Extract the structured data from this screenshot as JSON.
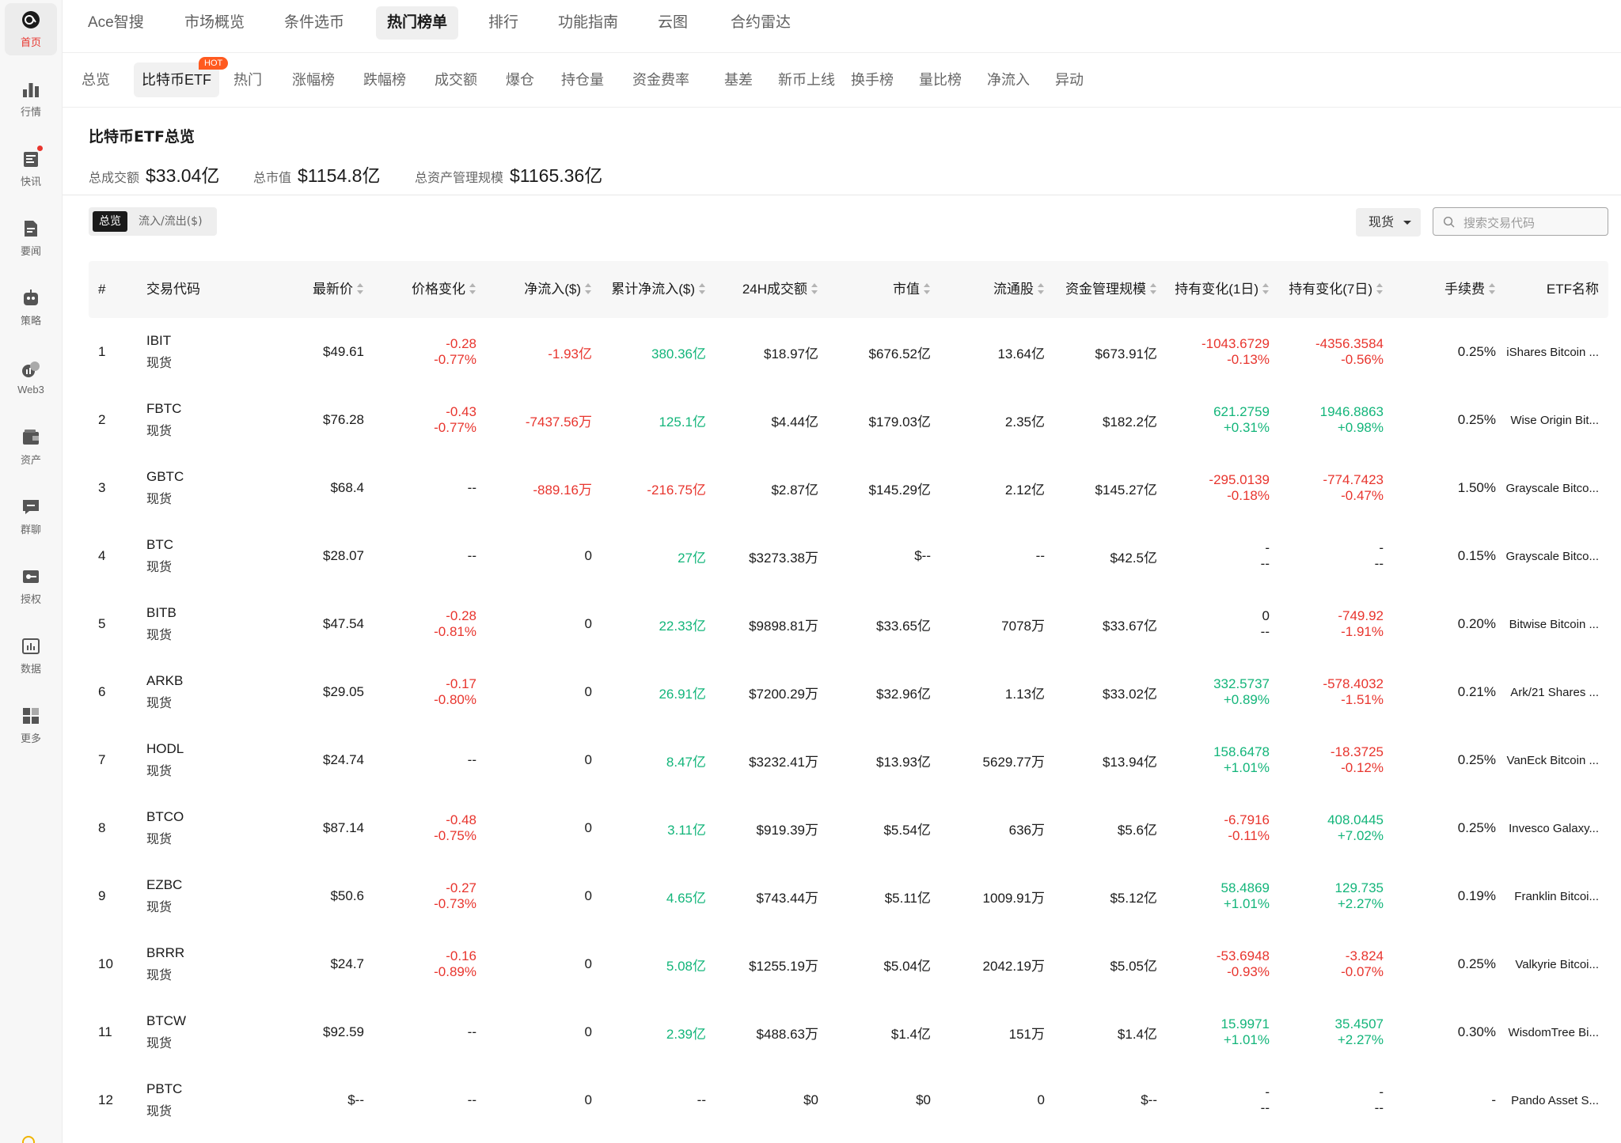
{
  "rail": [
    {
      "name": "rail-home",
      "icon": "home-logo-icon",
      "label": "首页",
      "active": true
    },
    {
      "name": "rail-market",
      "icon": "bar-chart-icon",
      "label": "行情"
    },
    {
      "name": "rail-flash",
      "icon": "news-icon",
      "label": "快讯"
    },
    {
      "name": "rail-news",
      "icon": "document-icon",
      "label": "要闻"
    },
    {
      "name": "rail-strategy",
      "icon": "robot-icon",
      "label": "策略"
    },
    {
      "name": "rail-web3",
      "icon": "web3-icon",
      "label": "Web3"
    },
    {
      "name": "rail-assets",
      "icon": "wallet-icon",
      "label": "资产"
    },
    {
      "name": "rail-chat",
      "icon": "chat-icon",
      "label": "群聊"
    },
    {
      "name": "rail-auth",
      "icon": "key-icon",
      "label": "授权"
    },
    {
      "name": "rail-data",
      "icon": "data-icon",
      "label": "数据"
    },
    {
      "name": "rail-more",
      "icon": "grid-icon",
      "label": "更多"
    }
  ],
  "topnav": [
    "Ace智搜",
    "市场概览",
    "条件选币",
    "热门榜单",
    "排行",
    "功能指南",
    "云图",
    "合约雷达"
  ],
  "topnav_active": "热门榜单",
  "subnav": [
    "总览",
    "比特币ETF",
    "热门",
    "涨幅榜",
    "跌幅榜",
    "成交额",
    "爆仓",
    "持仓量",
    "资金费率",
    "基差",
    "新币上线",
    "换手榜",
    "量比榜",
    "净流入",
    "异动"
  ],
  "subnav_active": "比特币ETF",
  "hot_badge": "HOT",
  "overview": {
    "title": "比特币ETF总览",
    "stats": [
      {
        "label": "总成交额",
        "value": "$33.04亿"
      },
      {
        "label": "总市值",
        "value": "$1154.8亿"
      },
      {
        "label": "总资产管理规模",
        "value": "$1165.36亿"
      }
    ]
  },
  "toggle": {
    "on": "总览",
    "off": "流入/流出($)"
  },
  "market_select": "现货",
  "search": {
    "placeholder": "搜索交易代码",
    "value": ""
  },
  "colors": {
    "up": "#13b57a",
    "down": "#e8352e",
    "accent": "#e8352e",
    "hot": "#ff5a1f"
  },
  "table": {
    "headers": [
      "#",
      "交易代码",
      "最新价",
      "价格变化",
      "净流入($)",
      "累计净流入($)",
      "24H成交额",
      "市值",
      "流通股",
      "资金管理规模",
      "持有变化(1日)",
      "持有变化(7日)",
      "手续费",
      "ETF名称"
    ],
    "rows": [
      {
        "n": "1",
        "code": "IBIT",
        "type": "现货",
        "price": "$49.61",
        "chg": [
          "-0.28",
          "-0.77%"
        ],
        "chg_c": "red",
        "net": "-1.93亿",
        "net_c": "red",
        "cum": "380.36亿",
        "cum_c": "green",
        "vol": "$18.97亿",
        "mcap": "$676.52亿",
        "shares": "13.64亿",
        "aum": "$673.91亿",
        "h1": [
          "-1043.6729",
          "-0.13%"
        ],
        "h1_c": "red",
        "h7": [
          "-4356.3584",
          "-0.56%"
        ],
        "h7_c": "red",
        "fee": "0.25%",
        "etf": "iShares Bitcoin ..."
      },
      {
        "n": "2",
        "code": "FBTC",
        "type": "现货",
        "price": "$76.28",
        "chg": [
          "-0.43",
          "-0.77%"
        ],
        "chg_c": "red",
        "net": "-7437.56万",
        "net_c": "red",
        "cum": "125.1亿",
        "cum_c": "green",
        "vol": "$4.44亿",
        "mcap": "$179.03亿",
        "shares": "2.35亿",
        "aum": "$182.2亿",
        "h1": [
          "621.2759",
          "+0.31%"
        ],
        "h1_c": "green",
        "h7": [
          "1946.8863",
          "+0.98%"
        ],
        "h7_c": "green",
        "fee": "0.25%",
        "etf": "Wise Origin Bit..."
      },
      {
        "n": "3",
        "code": "GBTC",
        "type": "现货",
        "price": "$68.4",
        "chg": [
          "--",
          ""
        ],
        "chg_c": "",
        "net": "-889.16万",
        "net_c": "red",
        "cum": "-216.75亿",
        "cum_c": "red",
        "vol": "$2.87亿",
        "mcap": "$145.29亿",
        "shares": "2.12亿",
        "aum": "$145.27亿",
        "h1": [
          "-295.0139",
          "-0.18%"
        ],
        "h1_c": "red",
        "h7": [
          "-774.7423",
          "-0.47%"
        ],
        "h7_c": "red",
        "fee": "1.50%",
        "etf": "Grayscale Bitco..."
      },
      {
        "n": "4",
        "code": "BTC",
        "type": "现货",
        "price": "$28.07",
        "chg": [
          "--",
          ""
        ],
        "chg_c": "",
        "net": "0",
        "net_c": "",
        "cum": "27亿",
        "cum_c": "green",
        "vol": "$3273.38万",
        "mcap": "$--",
        "shares": "--",
        "aum": "$42.5亿",
        "h1": [
          "-",
          "--"
        ],
        "h1_c": "",
        "h7": [
          "-",
          "--"
        ],
        "h7_c": "",
        "fee": "0.15%",
        "etf": "Grayscale Bitco..."
      },
      {
        "n": "5",
        "code": "BITB",
        "type": "现货",
        "price": "$47.54",
        "chg": [
          "-0.28",
          "-0.81%"
        ],
        "chg_c": "red",
        "net": "0",
        "net_c": "",
        "cum": "22.33亿",
        "cum_c": "green",
        "vol": "$9898.81万",
        "mcap": "$33.65亿",
        "shares": "7078万",
        "aum": "$33.67亿",
        "h1": [
          "0",
          "--"
        ],
        "h1_c": "",
        "h7": [
          "-749.92",
          "-1.91%"
        ],
        "h7_c": "red",
        "fee": "0.20%",
        "etf": "Bitwise Bitcoin ..."
      },
      {
        "n": "6",
        "code": "ARKB",
        "type": "现货",
        "price": "$29.05",
        "chg": [
          "-0.17",
          "-0.80%"
        ],
        "chg_c": "red",
        "net": "0",
        "net_c": "",
        "cum": "26.91亿",
        "cum_c": "green",
        "vol": "$7200.29万",
        "mcap": "$32.96亿",
        "shares": "1.13亿",
        "aum": "$33.02亿",
        "h1": [
          "332.5737",
          "+0.89%"
        ],
        "h1_c": "green",
        "h7": [
          "-578.4032",
          "-1.51%"
        ],
        "h7_c": "red",
        "fee": "0.21%",
        "etf": "Ark/21 Shares ..."
      },
      {
        "n": "7",
        "code": "HODL",
        "type": "现货",
        "price": "$24.74",
        "chg": [
          "--",
          ""
        ],
        "chg_c": "",
        "net": "0",
        "net_c": "",
        "cum": "8.47亿",
        "cum_c": "green",
        "vol": "$3232.41万",
        "mcap": "$13.93亿",
        "shares": "5629.77万",
        "aum": "$13.94亿",
        "h1": [
          "158.6478",
          "+1.01%"
        ],
        "h1_c": "green",
        "h7": [
          "-18.3725",
          "-0.12%"
        ],
        "h7_c": "red",
        "fee": "0.25%",
        "etf": "VanEck Bitcoin ..."
      },
      {
        "n": "8",
        "code": "BTCO",
        "type": "现货",
        "price": "$87.14",
        "chg": [
          "-0.48",
          "-0.75%"
        ],
        "chg_c": "red",
        "net": "0",
        "net_c": "",
        "cum": "3.11亿",
        "cum_c": "green",
        "vol": "$919.39万",
        "mcap": "$5.54亿",
        "shares": "636万",
        "aum": "$5.6亿",
        "h1": [
          "-6.7916",
          "-0.11%"
        ],
        "h1_c": "red",
        "h7": [
          "408.0445",
          "+7.02%"
        ],
        "h7_c": "green",
        "fee": "0.25%",
        "etf": "Invesco Galaxy..."
      },
      {
        "n": "9",
        "code": "EZBC",
        "type": "现货",
        "price": "$50.6",
        "chg": [
          "-0.27",
          "-0.73%"
        ],
        "chg_c": "red",
        "net": "0",
        "net_c": "",
        "cum": "4.65亿",
        "cum_c": "green",
        "vol": "$743.44万",
        "mcap": "$5.11亿",
        "shares": "1009.91万",
        "aum": "$5.12亿",
        "h1": [
          "58.4869",
          "+1.01%"
        ],
        "h1_c": "green",
        "h7": [
          "129.735",
          "+2.27%"
        ],
        "h7_c": "green",
        "fee": "0.19%",
        "etf": "Franklin Bitcoi..."
      },
      {
        "n": "10",
        "code": "BRRR",
        "type": "现货",
        "price": "$24.7",
        "chg": [
          "-0.16",
          "-0.89%"
        ],
        "chg_c": "red",
        "net": "0",
        "net_c": "",
        "cum": "5.08亿",
        "cum_c": "green",
        "vol": "$1255.19万",
        "mcap": "$5.04亿",
        "shares": "2042.19万",
        "aum": "$5.05亿",
        "h1": [
          "-53.6948",
          "-0.93%"
        ],
        "h1_c": "red",
        "h7": [
          "-3.824",
          "-0.07%"
        ],
        "h7_c": "red",
        "fee": "0.25%",
        "etf": "Valkyrie Bitcoi..."
      },
      {
        "n": "11",
        "code": "BTCW",
        "type": "现货",
        "price": "$92.59",
        "chg": [
          "--",
          ""
        ],
        "chg_c": "",
        "net": "0",
        "net_c": "",
        "cum": "2.39亿",
        "cum_c": "green",
        "vol": "$488.63万",
        "mcap": "$1.4亿",
        "shares": "151万",
        "aum": "$1.4亿",
        "h1": [
          "15.9971",
          "+1.01%"
        ],
        "h1_c": "green",
        "h7": [
          "35.4507",
          "+2.27%"
        ],
        "h7_c": "green",
        "fee": "0.30%",
        "etf": "WisdomTree Bi..."
      },
      {
        "n": "12",
        "code": "PBTC",
        "type": "现货",
        "price": "$--",
        "chg": [
          "--",
          ""
        ],
        "chg_c": "",
        "net": "0",
        "net_c": "",
        "cum": "--",
        "cum_c": "",
        "vol": "$0",
        "mcap": "$0",
        "shares": "0",
        "aum": "$--",
        "h1": [
          "-",
          "--"
        ],
        "h1_c": "",
        "h7": [
          "-",
          "--"
        ],
        "h7_c": "",
        "fee": "-",
        "etf": "Pando Asset S..."
      }
    ]
  }
}
